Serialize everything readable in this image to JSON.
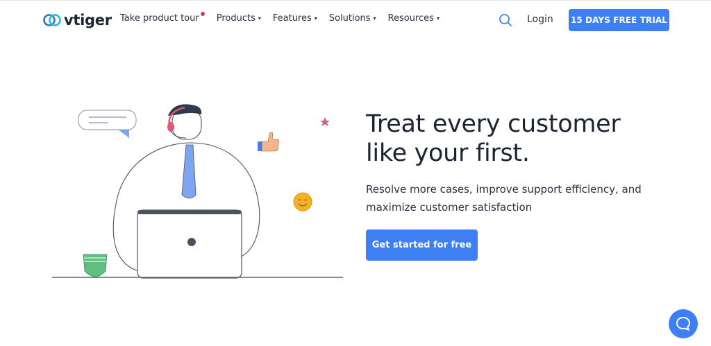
{
  "header": {
    "logo_text": "vtiger",
    "nav": [
      {
        "label": "Take product tour",
        "has_dot": true
      },
      {
        "label": "Products",
        "caret": "▾"
      },
      {
        "label": "Features",
        "caret": "▾"
      },
      {
        "label": "Solutions",
        "caret": "▾"
      },
      {
        "label": "Resources",
        "caret": "▾"
      }
    ],
    "login": "Login",
    "trial_button": "15 DAYS FREE TRIAL"
  },
  "hero": {
    "title_line1": "Treat every customer",
    "title_line2": "like your first.",
    "subtitle": "Resolve more cases, improve support efficiency, and maximize customer satisfaction",
    "cta": "Get started for free"
  },
  "icons": {
    "search": "search-icon",
    "chat": "chat-icon",
    "caret": "chevron-down-icon"
  },
  "colors": {
    "accent": "#3e7ff5",
    "text": "#1c2331",
    "tie": "#7ea6f0",
    "star": "#e05a74",
    "smiley": "#f5b125",
    "cup": "#5fbf80"
  }
}
